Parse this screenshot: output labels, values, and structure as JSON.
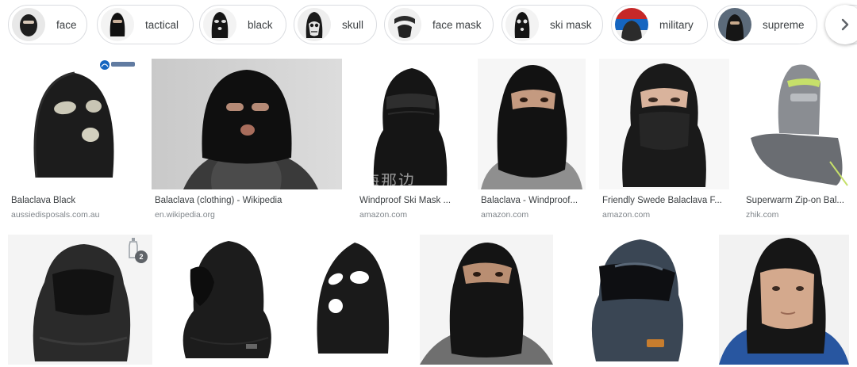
{
  "chips": [
    {
      "label": "face",
      "icon": "face-mask-thumb-icon"
    },
    {
      "label": "tactical",
      "icon": "tactical-balaclava-thumb-icon"
    },
    {
      "label": "black",
      "icon": "black-balaclava-thumb-icon"
    },
    {
      "label": "skull",
      "icon": "skull-mask-thumb-icon"
    },
    {
      "label": "face mask",
      "icon": "face-mask-thumb-icon"
    },
    {
      "label": "ski mask",
      "icon": "ski-mask-thumb-icon"
    },
    {
      "label": "military",
      "icon": "military-thumb-icon"
    },
    {
      "label": "supreme",
      "icon": "supreme-thumb-icon"
    }
  ],
  "results": [
    {
      "title": "Balaclava Black",
      "source": "aussiedisposals.com.au"
    },
    {
      "title": "Balaclava (clothing) - Wikipedia",
      "source": "en.wikipedia.org"
    },
    {
      "title": "Windproof Ski Mask ...",
      "source": "amazon.com"
    },
    {
      "title": "Balaclava - Windproof...",
      "source": "amazon.com"
    },
    {
      "title": "Friendly Swede Balaclava F...",
      "source": "amazon.com"
    },
    {
      "title": "Superwarm Zip-on Bal...",
      "source": "zhik.com"
    }
  ],
  "badge_count": "2",
  "watermark_text": "海那边",
  "colors": {
    "chip_border": "#dadce0",
    "title": "#3c4043",
    "source": "#80868b"
  }
}
